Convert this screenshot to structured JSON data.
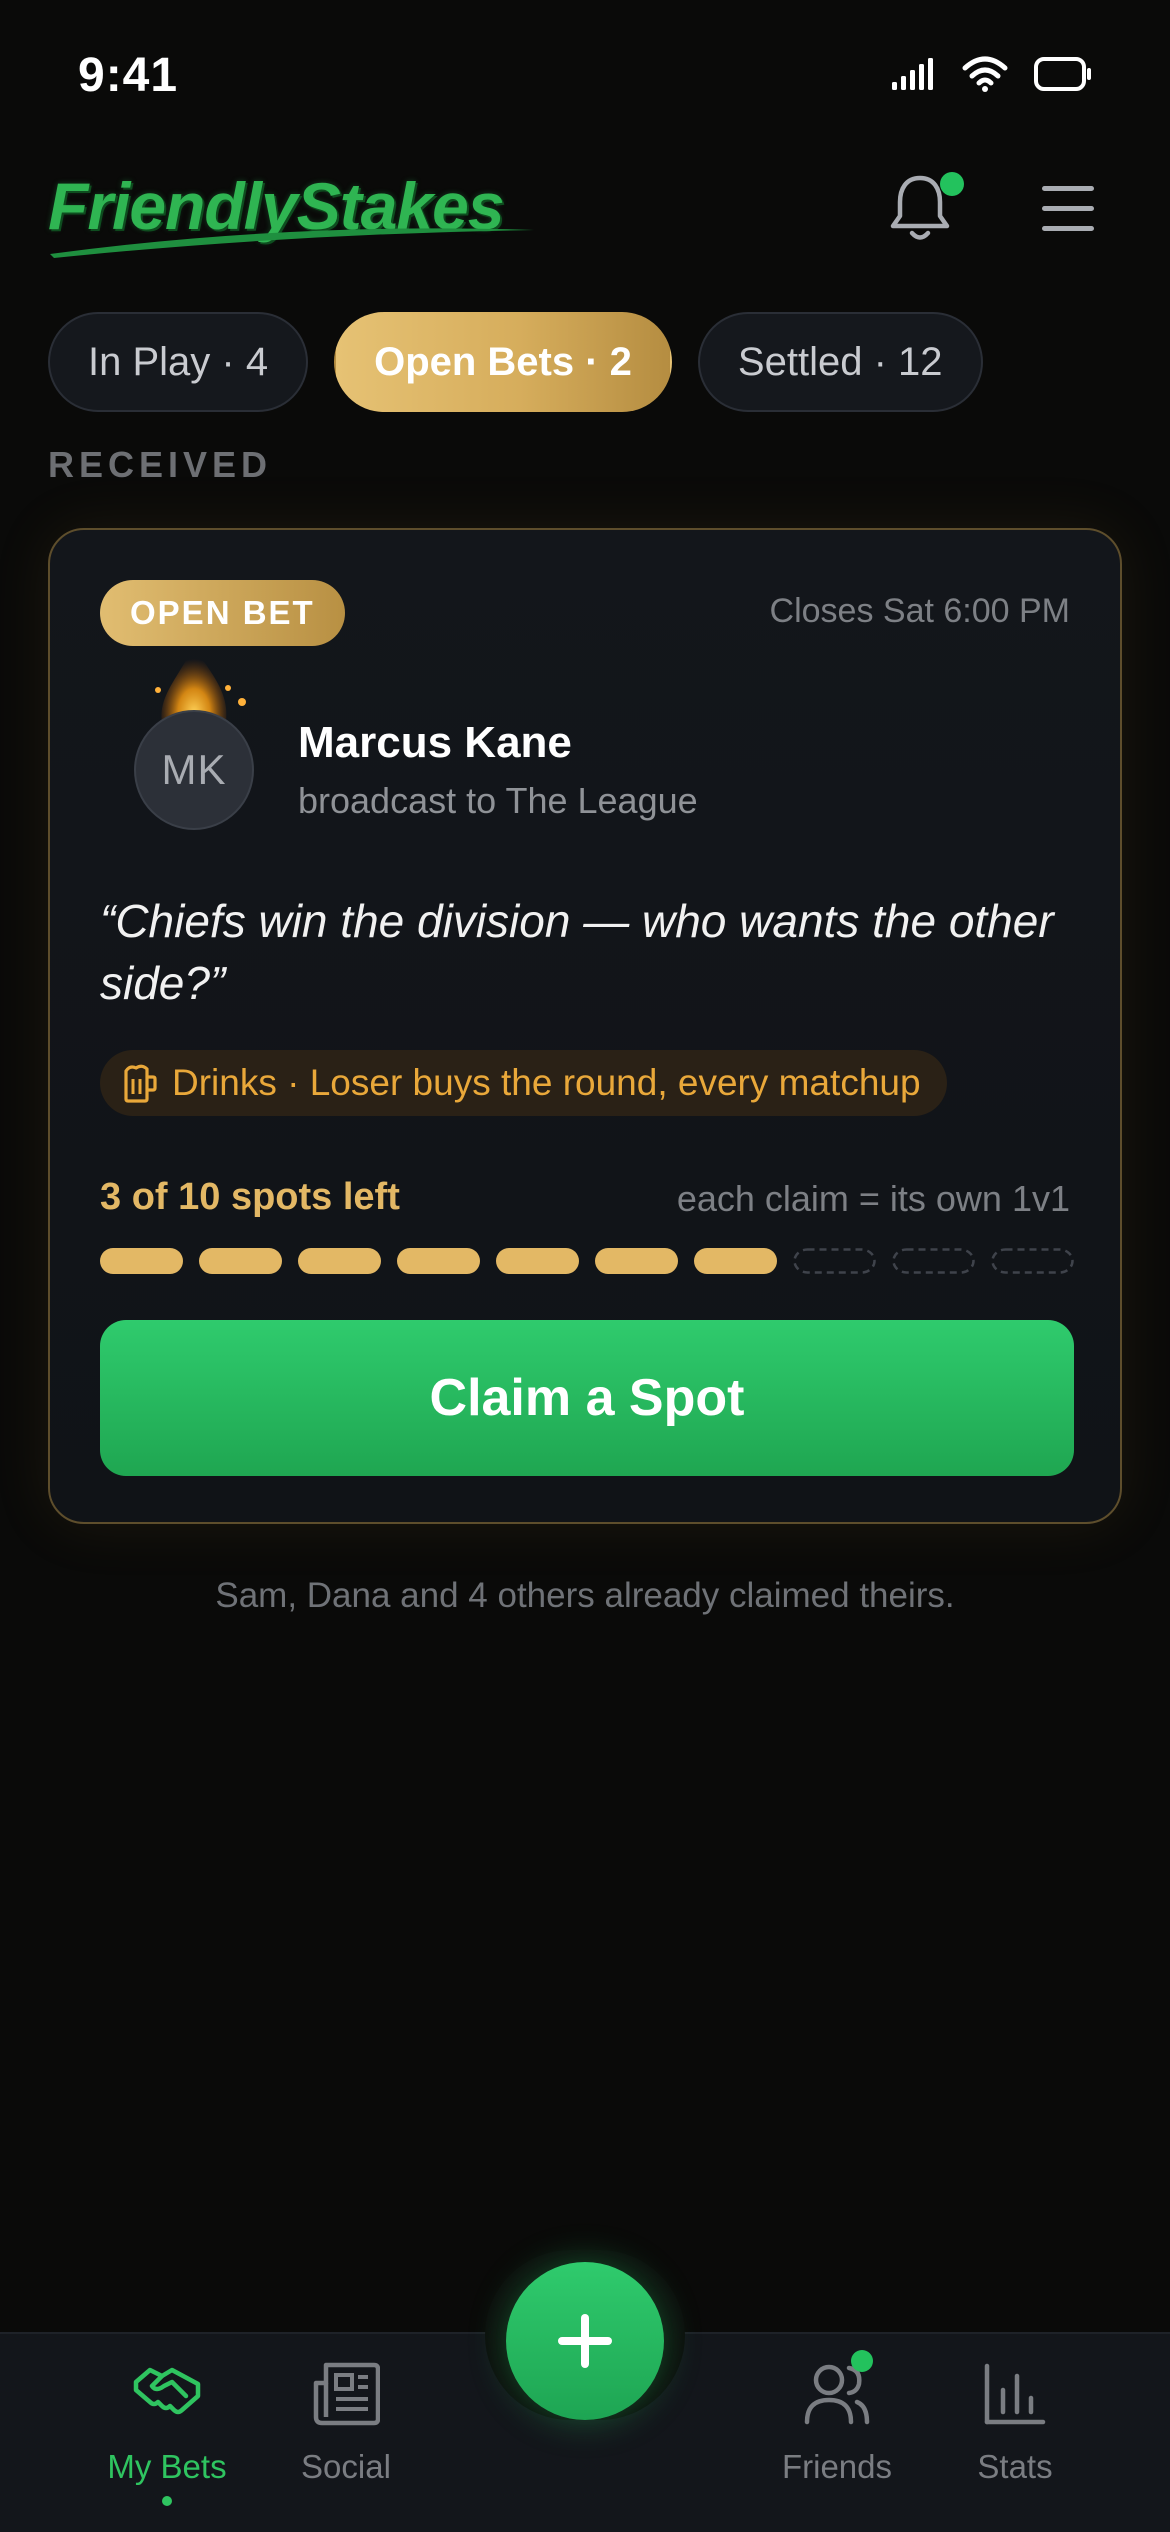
{
  "status_bar": {
    "time": "9:41"
  },
  "header": {
    "logo_text": "FriendlyStakes"
  },
  "tabs": [
    {
      "label": "In Play · 4",
      "active": false
    },
    {
      "label": "Open Bets · 2",
      "active": true
    },
    {
      "label": "Settled · 12",
      "active": false
    }
  ],
  "section_label": "RECEIVED",
  "card": {
    "badge": "OPEN BET",
    "closes": "Closes Sat 6:00 PM",
    "avatar_initials": "MK",
    "sender_name": "Marcus Kane",
    "sender_sub": "broadcast to The League",
    "quote": "“Chiefs win the division — who wants the other side?”",
    "stake": "Drinks · Loser buys the round, every matchup",
    "spots_left_text": "3 of 10 spots left",
    "spots_note": "each claim = its own 1v1",
    "spots_total": 10,
    "spots_claimed": 7,
    "claim_label": "Claim a Spot"
  },
  "footnote": "Sam, Dana and 4 others already claimed theirs.",
  "bottom_nav": {
    "items": [
      {
        "label": "My Bets",
        "icon": "handshake-icon",
        "active": true
      },
      {
        "label": "Social",
        "icon": "newspaper-icon",
        "active": false
      },
      {
        "label": "Friends",
        "icon": "friends-icon",
        "active": false
      },
      {
        "label": "Stats",
        "icon": "bar-chart-icon",
        "active": false
      }
    ],
    "fab_icon": "plus-icon"
  },
  "colors": {
    "accent_green": "#2fc460",
    "gold": "#d6ad5c",
    "background": "#0a0a09"
  }
}
